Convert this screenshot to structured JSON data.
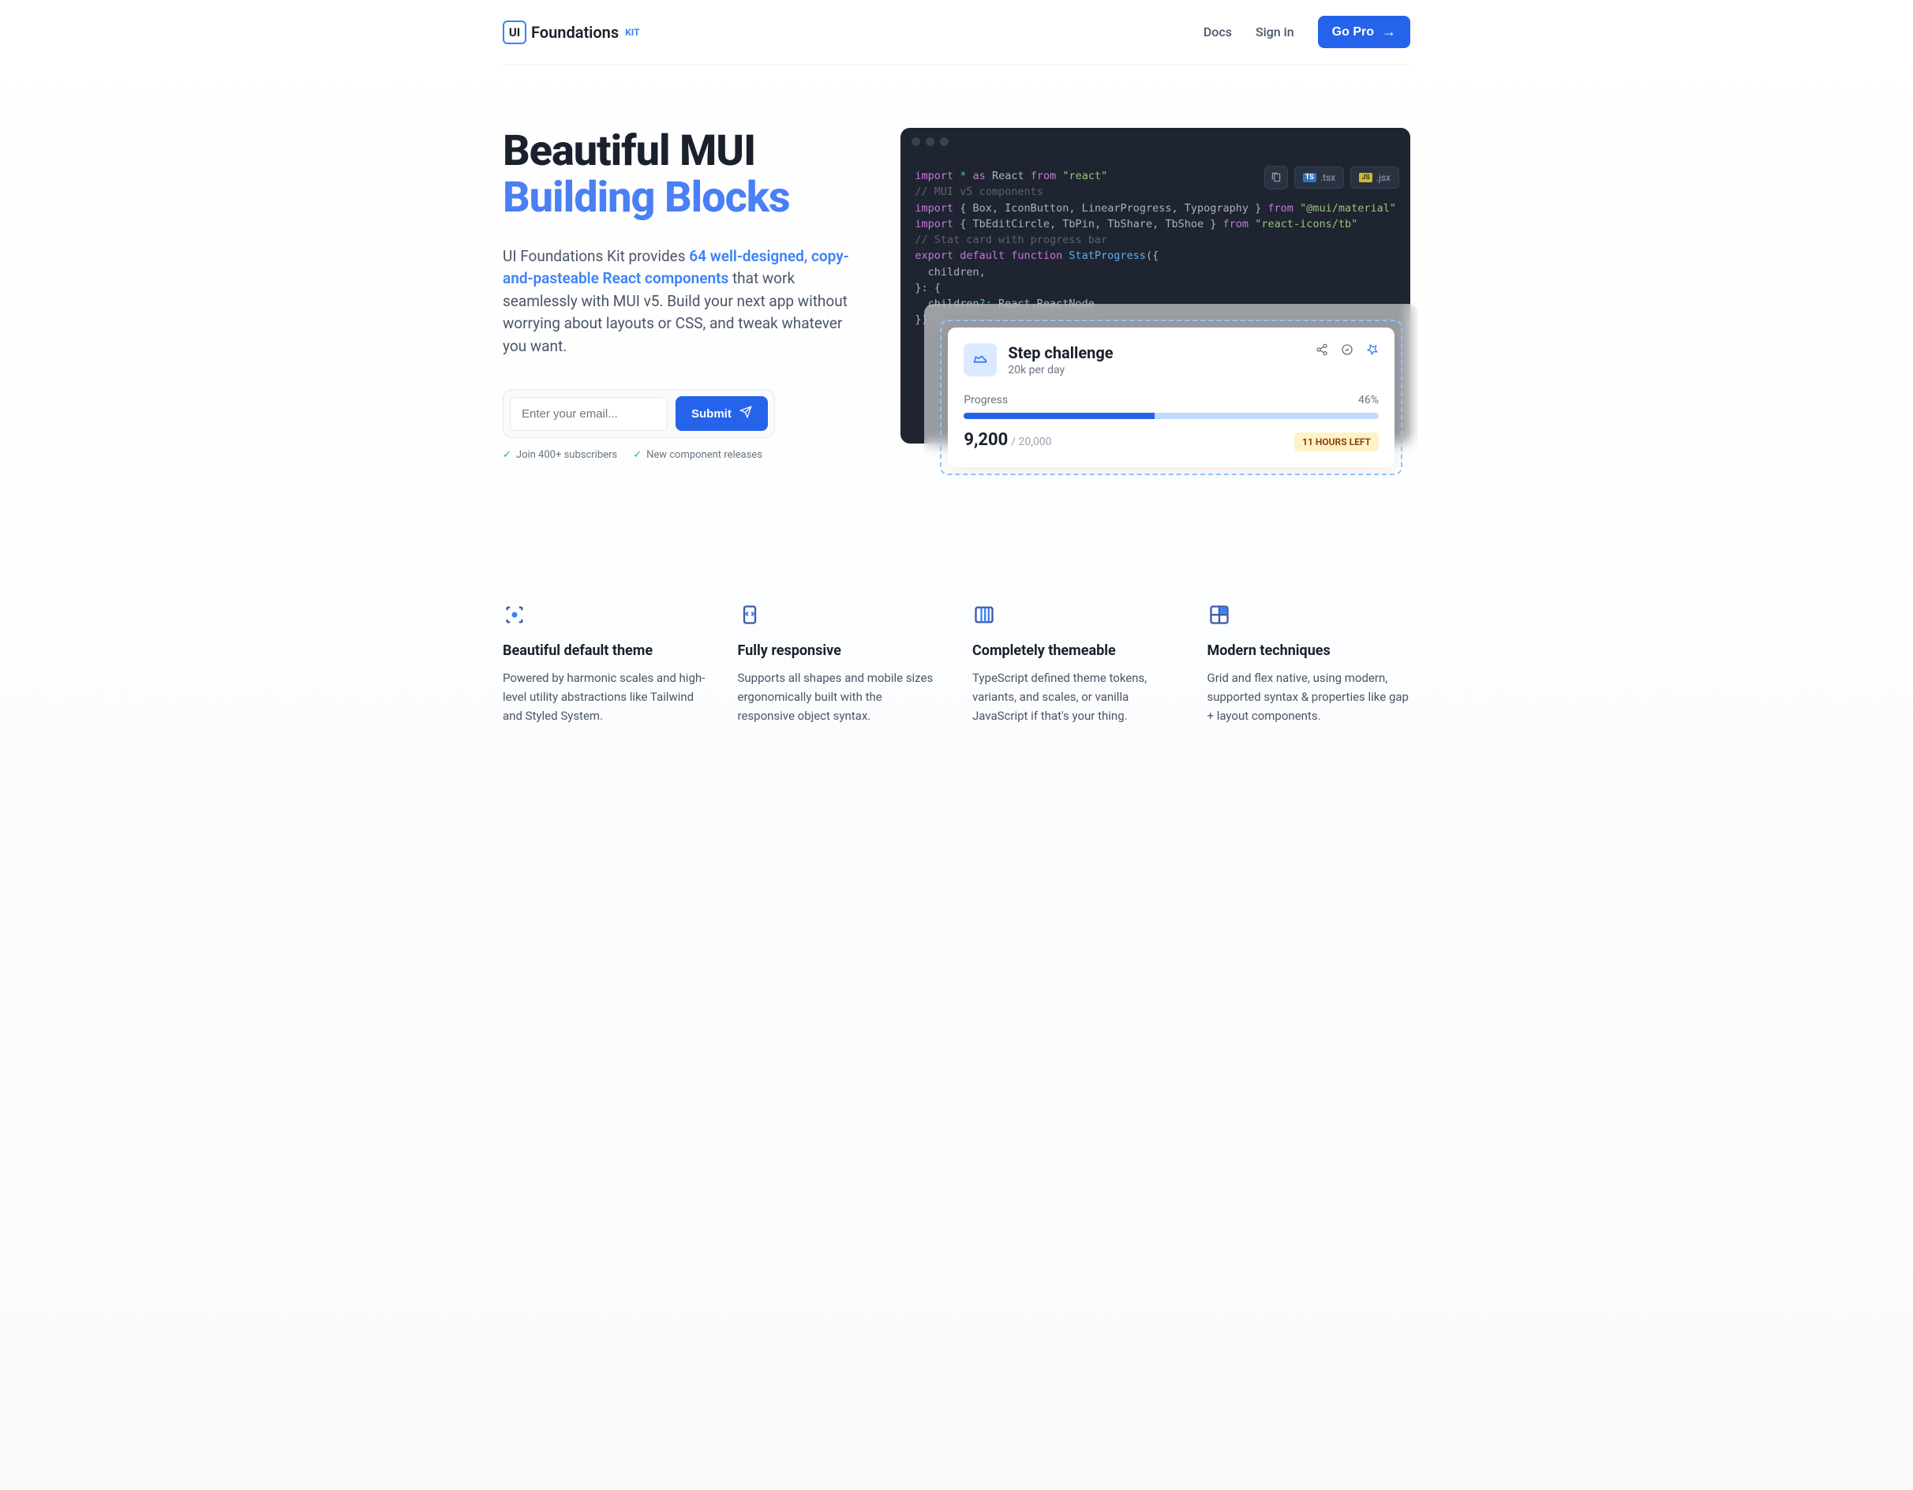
{
  "header": {
    "logo_text": "Foundations",
    "logo_kit": "KIT",
    "logo_ui": "UI",
    "nav": {
      "docs": "Docs",
      "signin": "Sign in",
      "gopro": "Go Pro"
    }
  },
  "hero": {
    "title_line1": "Beautiful MUI",
    "title_line2": "Building Blocks",
    "desc_prefix": "UI Foundations Kit provides ",
    "desc_highlight": "64 well-designed, copy-and-pasteable React components",
    "desc_suffix": " that work seamlessly with MUI v5. Build your next app without worrying about layouts or CSS, and tweak whatever you want.",
    "email_placeholder": "Enter your email...",
    "submit_label": "Submit",
    "meta1": "Join 400+ subscribers",
    "meta2": "New component releases"
  },
  "code": {
    "ext_tsx": ".tsx",
    "ext_jsx": ".jsx",
    "lines": {
      "l1_import": "import",
      "l1_star": "*",
      "l1_as": "as",
      "l1_react": "React",
      "l1_from": "from",
      "l1_str": "\"react\"",
      "l2": "// MUI v5 components",
      "l3_import": "import",
      "l3_names": "Box, IconButton, LinearProgress, Typography",
      "l3_from": "from",
      "l3_str": "\"@mui/material\"",
      "l4_import": "import",
      "l4_names": "TbEditCircle, TbPin, TbShare, TbShoe",
      "l4_from": "from",
      "l4_str": "\"react-icons/tb\"",
      "l5": "// Stat card with progress bar",
      "l6_export": "export default function",
      "l6_name": "StatProgress",
      "l6_open": "({",
      "l7": "  children,",
      "l8": "}: {",
      "l9a": "  children",
      "l9b": "?:",
      "l9c": " React.ReactNode",
      "l10": "}) {"
    }
  },
  "card": {
    "title": "Step challenge",
    "subtitle": "20k per day",
    "progress_label": "Progress",
    "progress_value": "46%",
    "count_current": "9,200",
    "count_total": "/ 20,000",
    "time_left": "11 HOURS LEFT"
  },
  "features": [
    {
      "title": "Beautiful default theme",
      "desc": "Powered by harmonic scales and high-level utility abstractions like Tailwind and Styled System."
    },
    {
      "title": "Fully responsive",
      "desc": "Supports all shapes and mobile sizes ergonomically built with the responsive object syntax."
    },
    {
      "title": "Completely themeable",
      "desc": "TypeScript defined theme tokens, variants, and scales, or vanilla JavaScript if that's your thing."
    },
    {
      "title": "Modern techniques",
      "desc": "Grid and flex native, using modern, supported syntax & properties like gap + layout components."
    }
  ]
}
